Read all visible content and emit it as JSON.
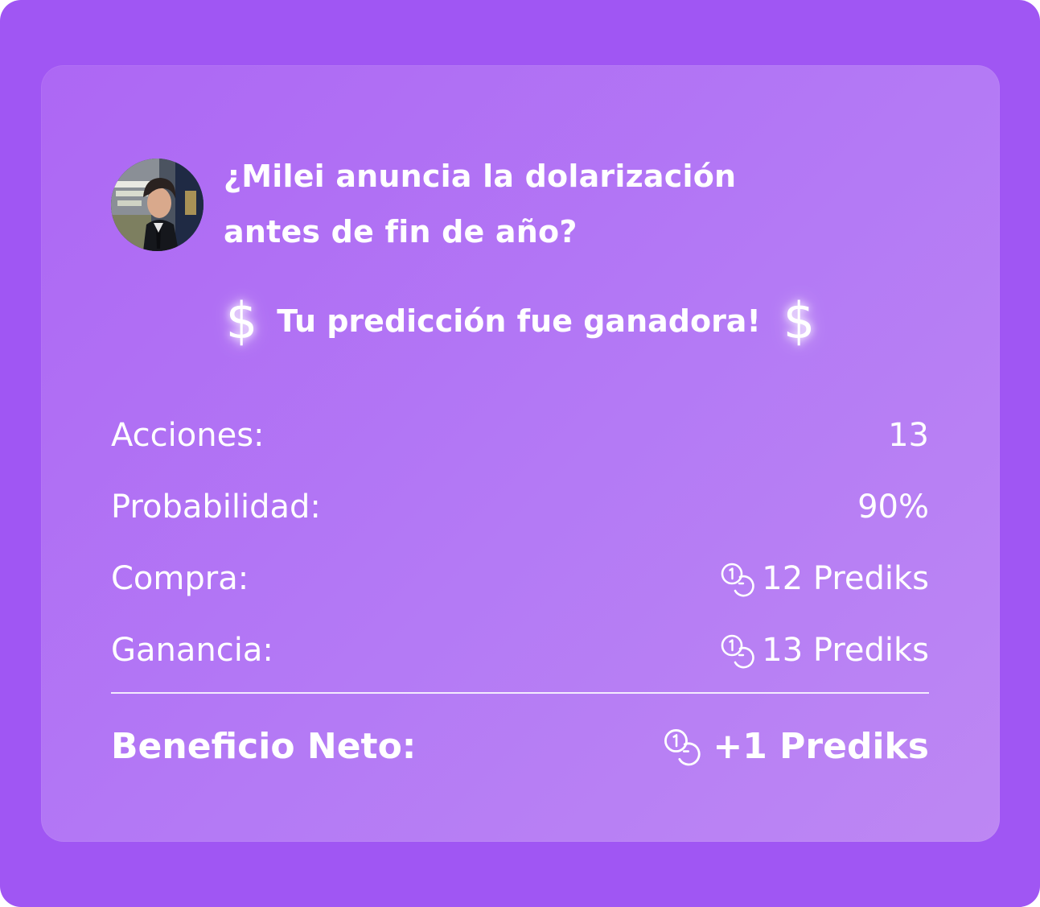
{
  "market": {
    "question": "¿Milei anuncia la dolarización antes de fin de año?"
  },
  "result": {
    "message": "Tu predicción fue ganadora!",
    "symbol_left": "$",
    "symbol_right": "$"
  },
  "stats": [
    {
      "label": "Acciones:",
      "value": "13",
      "icon": ""
    },
    {
      "label": "Probabilidad:",
      "value": "90%",
      "icon": ""
    },
    {
      "label": "Compra:",
      "value": "12 Prediks",
      "icon": "coins-icon"
    },
    {
      "label": "Ganancia:",
      "value": "13 Prediks",
      "icon": "coins-icon"
    }
  ],
  "net": {
    "label": "Beneficio Neto:",
    "value": "+1 Prediks",
    "icon": "coins-icon"
  },
  "colors": {
    "background": "#a056f3",
    "card": "#b47af5",
    "text": "#ffffff"
  }
}
